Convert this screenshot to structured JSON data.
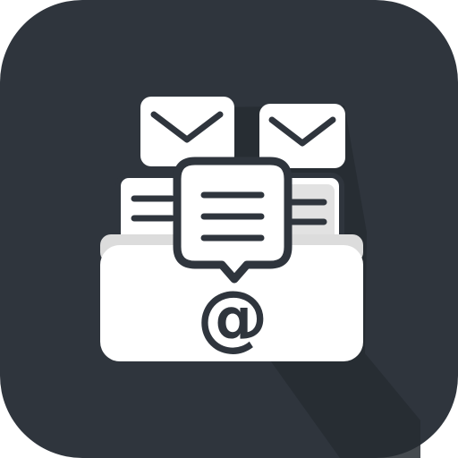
{
  "icon": {
    "name": "email-inbox-app-icon",
    "symbol": "@",
    "colors": {
      "background": "#2f353d",
      "shadow": "#262b31",
      "foreground": "#ffffff",
      "outline": "#2f353d",
      "accent_gray": "#dcdcdc"
    },
    "elements": [
      "envelope-icon",
      "envelope-icon",
      "document-icon",
      "document-icon",
      "chat-bubble-icon",
      "inbox-tray-icon",
      "at-sign-icon"
    ]
  }
}
